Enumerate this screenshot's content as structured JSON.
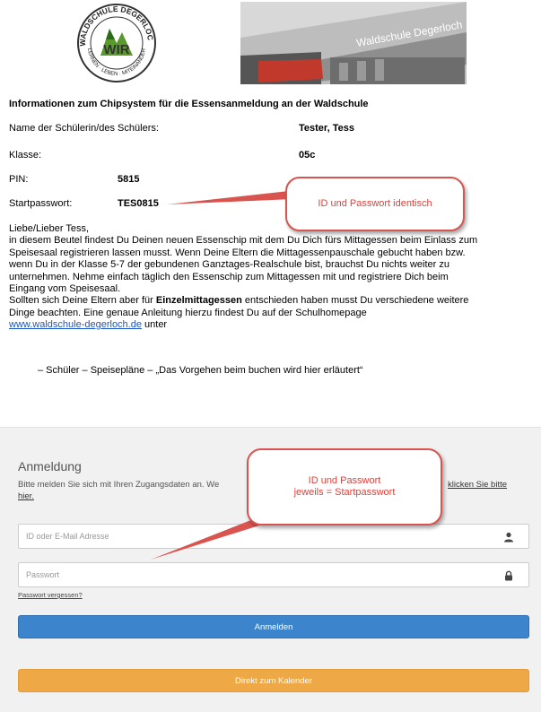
{
  "logo": {
    "ring_text": "WALDSCHULE DEGERLOCH",
    "bottom_text": "LERNEN · LEBEN · MITEINANDER",
    "mark": "WIR"
  },
  "photo": {
    "building_text": "Waldschule Degerloch"
  },
  "doc": {
    "title": "Informationen zum Chipsystem für die Essensanmeldung an der Waldschule",
    "name_label": "Name der Schülerin/des Schülers:",
    "name_value": "Tester, Tess",
    "class_label": "Klasse:",
    "class_value": "05c",
    "pin_label": "PIN:",
    "pin_value": "5815",
    "pw_label": "Startpasswort:",
    "pw_value": "TES0815",
    "letter": {
      "l1": "Liebe/Lieber Tess,",
      "l2": "in diesem Beutel findest Du Deinen neuen Essenschip mit dem Du Dich fürs Mittagessen beim Einlass zum",
      "l3": "Speisesaal registrieren lassen musst. Wenn Deine Eltern die Mittagessenpauschale gebucht haben bzw.",
      "l4": "wenn Du in der Klasse 5-7 der gebundenen Ganztages-Realschule bist, brauchst Du nichts weiter zu",
      "l5": "unternehmen. Nehme einfach täglich den Essenschip zum Mittagessen mit und registriere Dich beim",
      "l6": "Eingang vom Speisesaal.",
      "l7a": "Sollten sich Deine Eltern aber für ",
      "l7b": "Einzelmittagessen",
      "l7c": " entschieden haben musst Du verschiedene weitere",
      "l8": "Dinge beachten. Eine genaue Anleitung hierzu findest Du auf der Schulhomepage",
      "link": "www.waldschule-degerloch.de",
      "l9": " unter"
    },
    "bullet": "–   Schüler – Speisepläne – „Das Vorgehen beim buchen wird hier erläutert“"
  },
  "callouts": {
    "c1": "ID und Passwort identisch",
    "c2_line1": "ID und Passwort",
    "c2_line2": "jeweils = Startpasswort"
  },
  "login": {
    "title": "Anmeldung",
    "hint_start": "Bitte melden Sie sich mit Ihren Zugangsdaten an. We",
    "hint_link": "klicken Sie bitte",
    "hint_link2": "hier.",
    "id_placeholder": "ID oder E-Mail Adresse",
    "pw_placeholder": "Passwort",
    "forgot": "Passwort vergessen?",
    "login_button": "Anmelden",
    "calendar_button": "Direkt zum Kalender"
  },
  "colors": {
    "callout_border": "#d9534f",
    "callout_text": "#e0403a",
    "login_btn": "#3c84cb",
    "calendar_btn": "#efa846",
    "link": "#1a55c4"
  }
}
